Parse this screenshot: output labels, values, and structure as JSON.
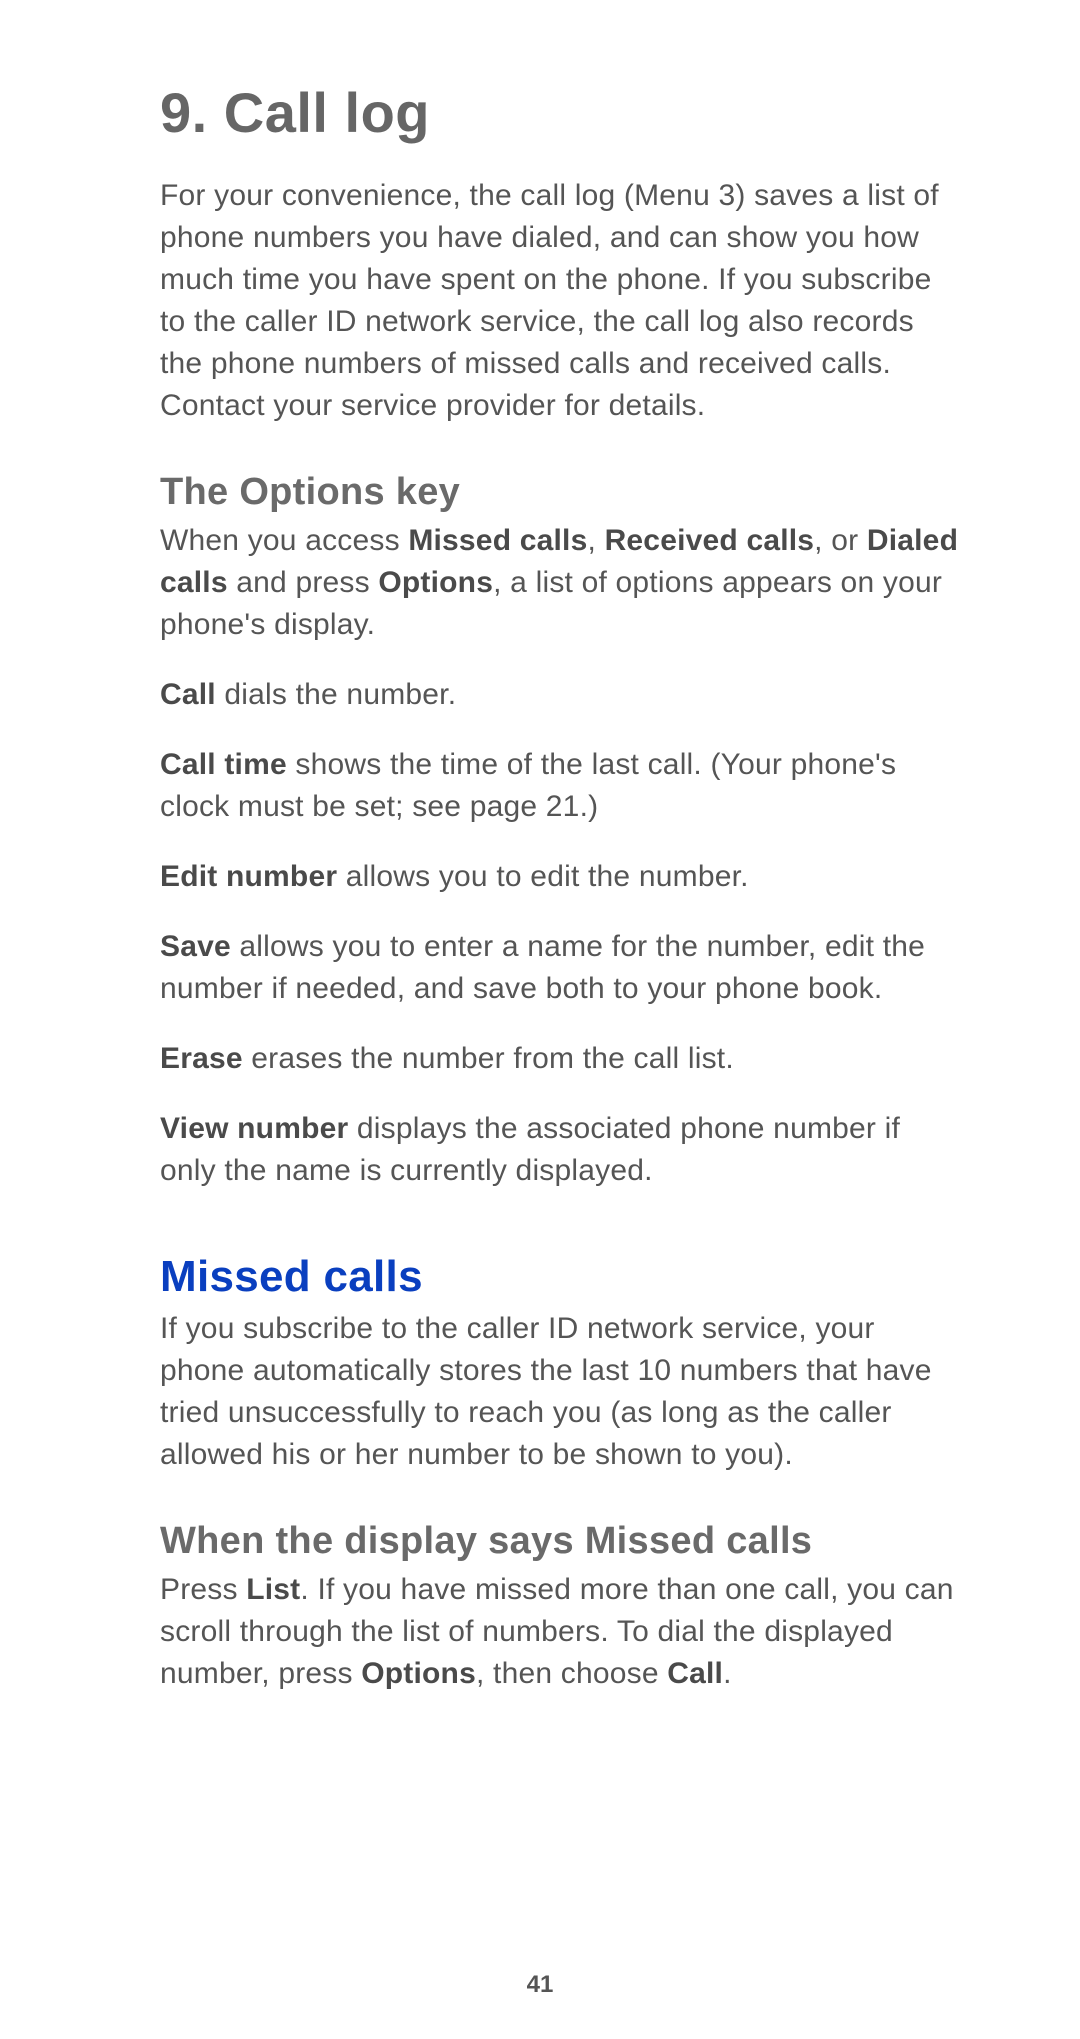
{
  "chapter": {
    "number": "9.",
    "title": "Call log",
    "intro": "For your convenience, the call log (Menu 3) saves a list of phone numbers you have dialed, and can show you how much time you have spent on the phone. If you subscribe to the caller ID network service, the call log also records the phone numbers of missed calls and received calls. Contact your service provider for details."
  },
  "options_key": {
    "heading": "The Options key",
    "intro_pre": "When you access ",
    "intro_b1": "Missed calls",
    "intro_sep1": ", ",
    "intro_b2": "Received calls",
    "intro_sep2": ", or ",
    "intro_b3": "Dialed calls",
    "intro_mid": " and press ",
    "intro_b4": "Options",
    "intro_post": ", a list of options appears on your phone's display.",
    "item_call_b": "Call",
    "item_call_t": " dials the number.",
    "item_calltime_b": "Call time",
    "item_calltime_t": " shows the time of the last call. (Your phone's clock must be set; see page 21.)",
    "item_edit_b": "Edit number",
    "item_edit_t": " allows you to edit the number.",
    "item_save_b": "Save",
    "item_save_t": " allows you to enter a name for the number, edit the number if needed, and save both to your phone book.",
    "item_erase_b": "Erase",
    "item_erase_t": " erases the number from the call list.",
    "item_view_b": "View number",
    "item_view_t": " displays the associated phone number if only the name is currently displayed."
  },
  "missed_calls": {
    "heading": "Missed calls",
    "intro": "If you subscribe to the caller ID network service, your phone automatically stores the last 10 numbers that have tried unsuccessfully to reach you (as long as the caller allowed his or her number to be shown to you).",
    "sub_heading": "When the display says Missed calls",
    "sub_pre": "Press ",
    "sub_b1": "List",
    "sub_mid1": ". If you have missed more than one call, you can scroll through the list of numbers. To dial the displayed number, press ",
    "sub_b2": "Options",
    "sub_mid2": ", then choose ",
    "sub_b3": "Call",
    "sub_post": "."
  },
  "page_number": "41"
}
